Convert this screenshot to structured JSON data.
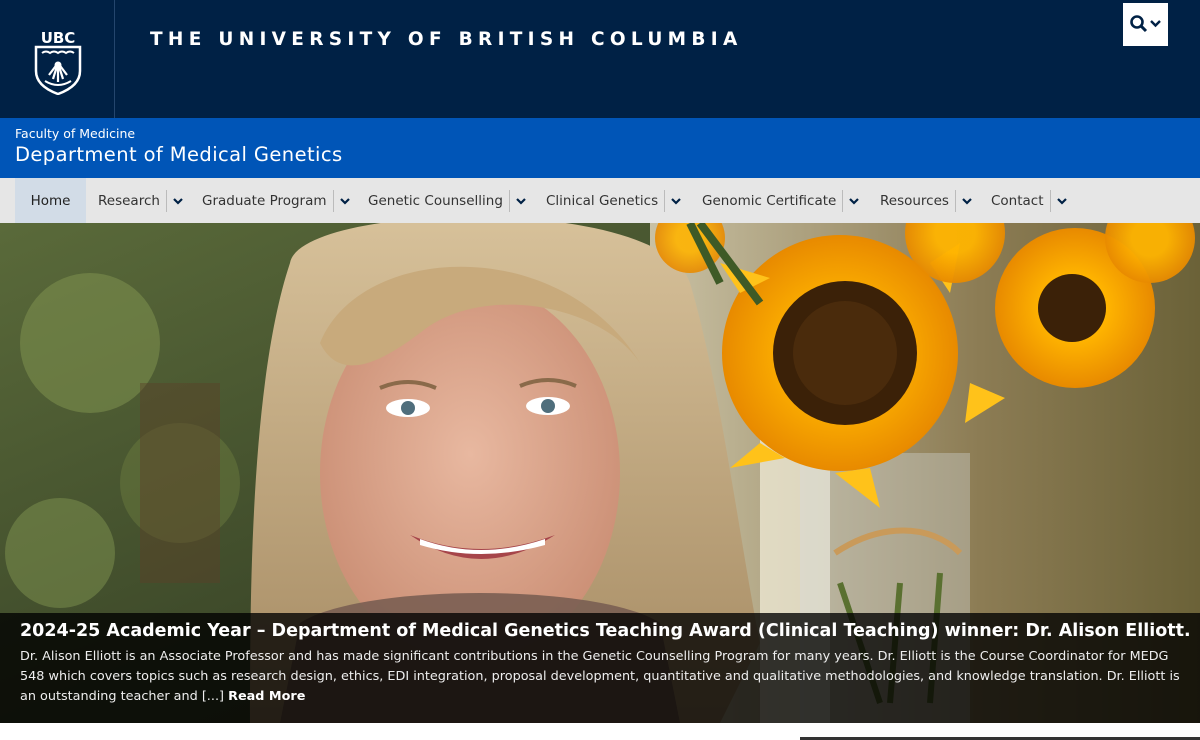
{
  "header": {
    "university_name": "THE UNIVERSITY OF BRITISH COLUMBIA",
    "logo_text": "UBC",
    "search_icon": "search-icon",
    "colors": {
      "navy": "#002145",
      "blue": "#0055b7"
    }
  },
  "faculty": {
    "faculty_name": "Faculty of Medicine",
    "department_name": "Department of Medical Genetics"
  },
  "nav": {
    "items": [
      {
        "label": "Home",
        "has_dropdown": false,
        "active": true
      },
      {
        "label": "Research",
        "has_dropdown": true
      },
      {
        "label": "Graduate Program",
        "has_dropdown": true
      },
      {
        "label": "Genetic Counselling",
        "has_dropdown": true
      },
      {
        "label": "Clinical Genetics",
        "has_dropdown": true
      },
      {
        "label": "Genomic Certificate",
        "has_dropdown": true
      },
      {
        "label": "Resources",
        "has_dropdown": true
      },
      {
        "label": "Contact",
        "has_dropdown": true
      }
    ]
  },
  "hero": {
    "title": "2024-25 Academic Year – Department of Medical Genetics Teaching Award (Clinical Teaching) winner: Dr. Alison Elliott.",
    "body": "Dr. Alison Elliott is an Associate Professor and has made significant contributions in the Genetic Counselling Program for many years. Dr. Elliott is the Course Coordinator for MEDG 548 which covers topics such as research design, ethics, EDI integration, proposal development, quantitative and qualitative methodologies, and knowledge translation. Dr. Elliott is an outstanding teacher and [...]",
    "read_more": "Read More"
  }
}
